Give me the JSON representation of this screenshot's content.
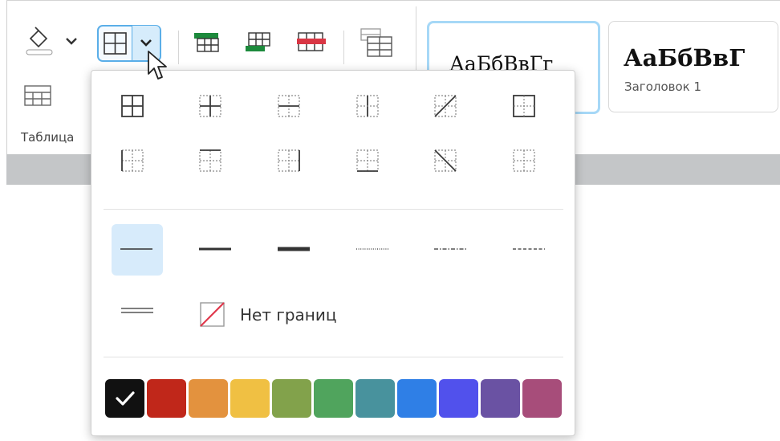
{
  "toolbar": {
    "group_label": "Таблица",
    "styles": [
      {
        "sample": "АаБбВвГг",
        "name": ""
      },
      {
        "sample": "АаБбВвГ",
        "name": "Заголовок 1"
      }
    ],
    "icons": {
      "fill": "fill-bucket-icon",
      "borders": "all-borders-icon",
      "insert_row_above": "insert-row-above-icon",
      "insert_row_below": "insert-row-below-icon",
      "delete_row": "delete-row-icon",
      "table_properties": "table-properties-icon",
      "table_grid": "table-grid-icon"
    }
  },
  "dropdown": {
    "border_presets": [
      "all-borders",
      "inner-borders",
      "inner-horizontal",
      "inner-vertical",
      "diagonal-up",
      "no-inner",
      "left-border",
      "top-border",
      "right-border",
      "bottom-border",
      "diagonal-down",
      "no-borders-preset"
    ],
    "line_styles": [
      "thin",
      "medium",
      "thick",
      "dotted",
      "dash-dot",
      "dashed",
      "double"
    ],
    "selected_line_style": "thin",
    "no_borders_label": "Нет границ",
    "colors": [
      "#111111",
      "#c0271a",
      "#e3923e",
      "#f0c043",
      "#82a24b",
      "#50a45d",
      "#48929d",
      "#2f7fe6",
      "#5151ec",
      "#6a52a3",
      "#a74d7a"
    ],
    "selected_color_index": 0
  }
}
